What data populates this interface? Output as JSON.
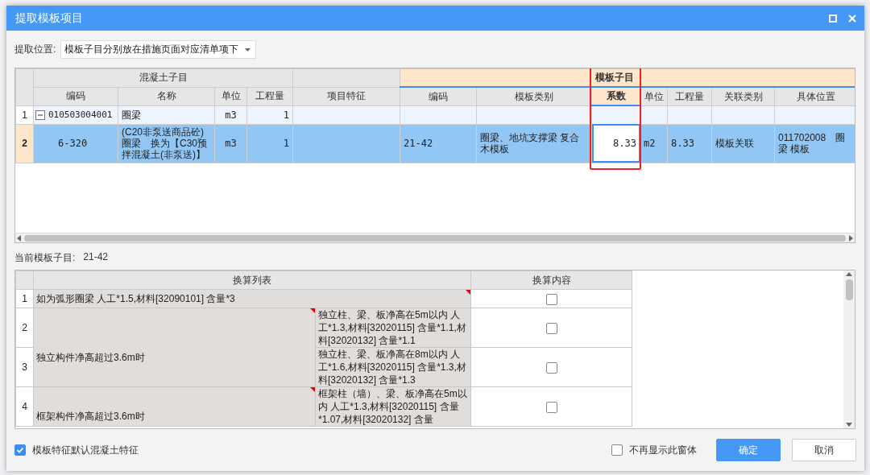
{
  "window": {
    "title": "提取模板项目"
  },
  "location": {
    "label": "提取位置:",
    "value": "模板子目分别放在措施页面对应清单项下"
  },
  "upper_table": {
    "groups": [
      {
        "label": "混凝土子目",
        "kind": "plain",
        "columns": [
          {
            "label": "编码",
            "selected": false
          },
          {
            "label": "名称",
            "selected": false
          },
          {
            "label": "单位",
            "selected": false
          },
          {
            "label": "工程量",
            "selected": false
          }
        ]
      },
      {
        "kind": "plain",
        "columns": [
          {
            "label": "项目特征",
            "selected": false
          }
        ]
      },
      {
        "label": "模板子目",
        "kind": "accent",
        "columns": [
          {
            "label": "编码",
            "selected": false
          },
          {
            "label": "模板类别",
            "selected": false
          },
          {
            "label": "系数",
            "selected": true
          },
          {
            "label": "单位",
            "selected": false
          },
          {
            "label": "工程量",
            "selected": false
          },
          {
            "label": "关联类别",
            "selected": false
          },
          {
            "label": "具体位置",
            "selected": false
          }
        ]
      }
    ],
    "rows": [
      {
        "number": "1",
        "kind": "parent",
        "expanded": true,
        "selected": false,
        "cells": [
          "010503004001",
          "圈梁",
          "m3",
          "1",
          "",
          "",
          "",
          "",
          "",
          "",
          "",
          ""
        ]
      },
      {
        "number": "2",
        "kind": "child",
        "selected": true,
        "cells": [
          "6-320",
          "(C20非泵送商品砼)圈梁　换为【C30预拌混凝土(非泵送)】",
          "m3",
          "1",
          "",
          "21-42",
          "圈梁、地坑支撑梁 复合木模板",
          "8.33",
          "m2",
          "8.33",
          "模板关联",
          "011702008　圈梁 模板"
        ]
      }
    ]
  },
  "current_item": {
    "label": "当前模板子目:",
    "value": "21-42"
  },
  "conversion_table": {
    "columns": [
      "换算列表",
      "换算内容"
    ],
    "rows": [
      {
        "kind": "single",
        "number": "1",
        "text": "如为弧形圈梁 人工*1.5,材料[32090101] 含量*3",
        "flagged": true,
        "checked": false
      },
      {
        "kind": "group",
        "label": "独立构件净高超过3.6m时",
        "flagged": true,
        "items": [
          {
            "number": "2",
            "text": "独立柱、梁、板净高在5m以内 人工*1.3,材料[32020115] 含量*1.1,材料[32020132] 含量*1.1",
            "checked": false
          },
          {
            "number": "3",
            "text": "独立柱、梁、板净高在8m以内 人工*1.6,材料[32020115] 含量*1.3,材料[32020132] 含量*1.3",
            "checked": false
          }
        ]
      },
      {
        "kind": "group",
        "label": "框架构件净高超过3.6m时",
        "flagged": true,
        "items": [
          {
            "number": "4",
            "text": "框架柱（墙）、梁、板净高在5m以内 人工*1.3,材料[32020115] 含量*1.07,材料[32020132] 含量",
            "checked": false
          }
        ]
      }
    ]
  },
  "footer": {
    "inherit": {
      "label": "模板特征默认混凝土特征",
      "checked": true
    },
    "hide": {
      "label": "不再显示此窗体",
      "checked": false
    },
    "buttons": [
      {
        "label": "确定",
        "kind": "primary"
      },
      {
        "label": "取消",
        "kind": "secondary"
      }
    ]
  }
}
